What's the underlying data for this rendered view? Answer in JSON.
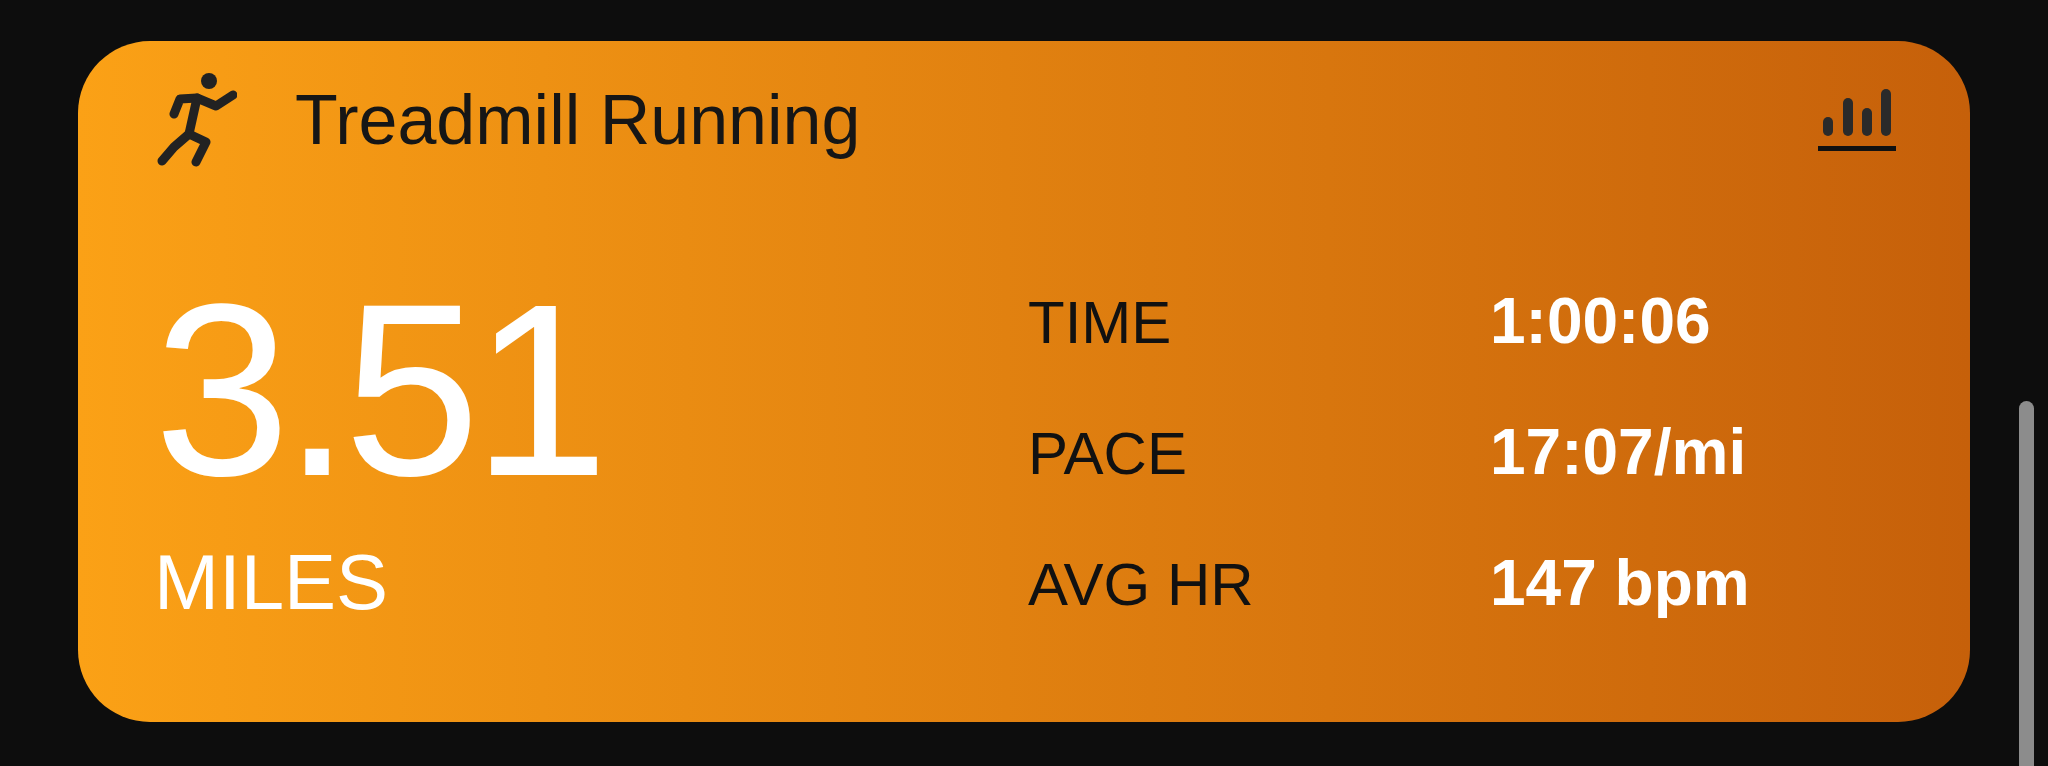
{
  "card": {
    "title": "Treadmill Running",
    "distance": {
      "value": "3.51",
      "unit": "MILES"
    },
    "metrics": [
      {
        "label": "TIME",
        "value": "1:00:06"
      },
      {
        "label": "PACE",
        "value": "17:07/mi"
      },
      {
        "label": "AVG HR",
        "value": "147 bpm"
      }
    ]
  }
}
